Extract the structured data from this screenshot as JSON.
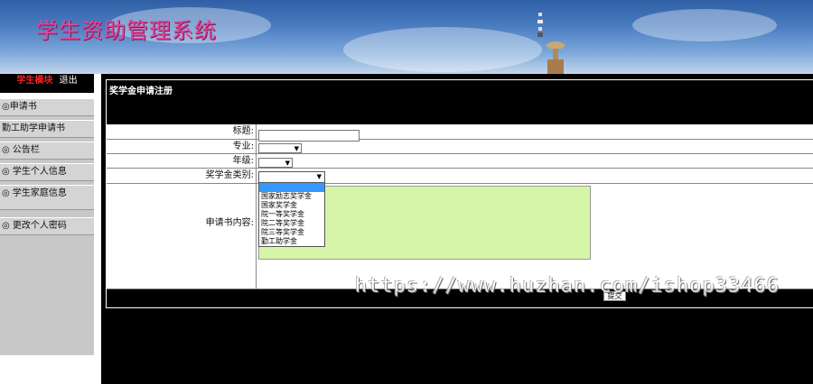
{
  "header": {
    "title": "学生资助管理系统"
  },
  "sidebar": {
    "module_label": "学生模块",
    "logout_label": "退出",
    "items": [
      {
        "label": "◎申请书"
      },
      {
        "label": "勤工助学申请书"
      },
      {
        "label": "◎ 公告栏"
      },
      {
        "label": "◎ 学生个人信息"
      },
      {
        "label": "◎ 学生家庭信息"
      },
      {
        "label": "◎ 更改个人密码"
      }
    ]
  },
  "main": {
    "title": "奖学金申请注册",
    "form": {
      "title_label": "标题:",
      "major_label": "专业:",
      "grade_label": "年级:",
      "category_label": "奖学金类别:",
      "content_label": "申请书内容:",
      "title_value": "",
      "major_value": "",
      "grade_value": "",
      "category_value": ""
    },
    "category_options": [
      "国家励志奖学金",
      "国家奖学金",
      "院一等奖学金",
      "院二等奖学金",
      "院三等奖学金",
      "勤工助学金"
    ],
    "submit_label": "提交"
  },
  "watermark": "https://www.huzhan.com/ishop33466"
}
